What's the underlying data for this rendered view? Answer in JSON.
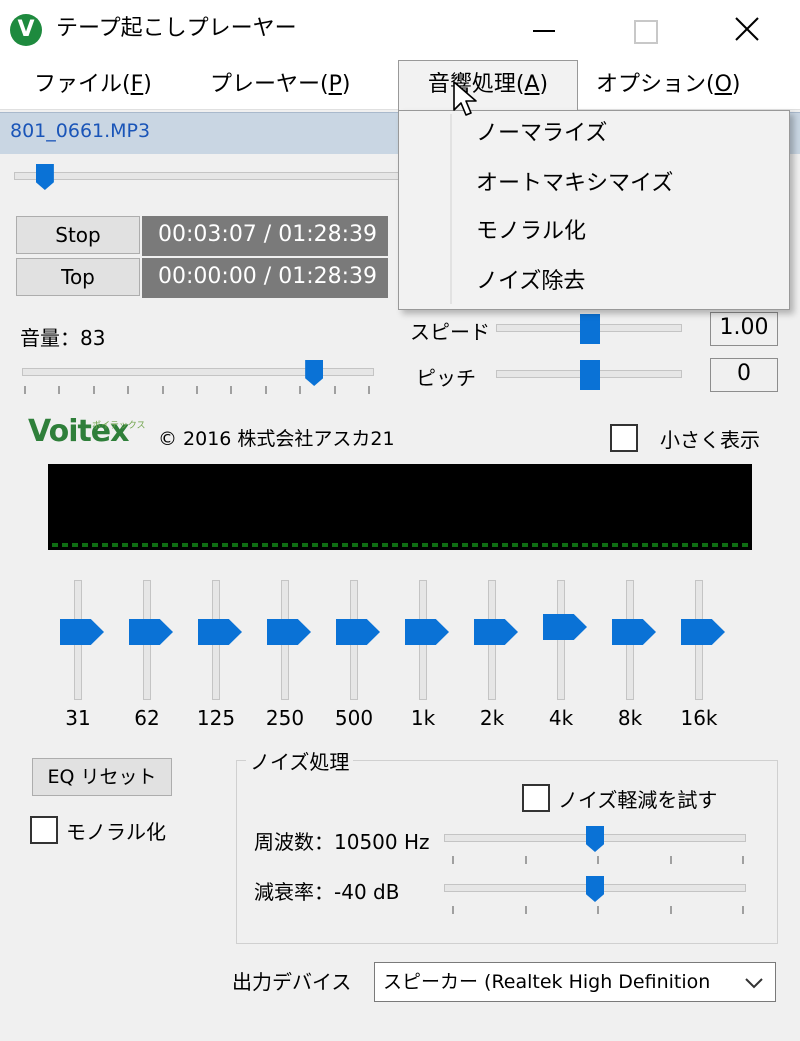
{
  "window": {
    "title": "テープ起こしプレーヤー",
    "icon_letter": "V"
  },
  "menu": {
    "file": {
      "text": "ファイル(",
      "key": "F",
      "end": ")"
    },
    "player": {
      "text": "プレーヤー(",
      "key": "P",
      "end": ")"
    },
    "audio": {
      "text": "音響処理(",
      "key": "A",
      "end": ")"
    },
    "options": {
      "text": "オプション(",
      "key": "O",
      "end": ")"
    }
  },
  "dropdown": {
    "items": [
      "ノーマライズ",
      "オートマキシマイズ",
      "モノラル化",
      "ノイズ除去"
    ]
  },
  "file": {
    "name": "801_0661.MP3"
  },
  "playback": {
    "position_fraction": 0.08,
    "stop_label": "Stop",
    "top_label": "Top",
    "current_time": "00:03:07 / 01:28:39",
    "top_time": "00:00:00 / 01:28:39"
  },
  "volume": {
    "label": "音量：83",
    "value": 83
  },
  "speed": {
    "label": "スピード",
    "value": "1.00"
  },
  "pitch": {
    "label": "ピッチ",
    "value": "0"
  },
  "brand": {
    "logo": "Voitex",
    "logo_ruby": "ボイテックス",
    "copyright": "© 2016 株式会社アスカ21"
  },
  "small_display": {
    "label": "小さく表示",
    "checked": false
  },
  "eq": {
    "bands": [
      "31",
      "62",
      "125",
      "250",
      "500",
      "1k",
      "2k",
      "4k",
      "8k",
      "16k"
    ],
    "reset_label": "EQ リセット"
  },
  "mono": {
    "label": "モノラル化",
    "checked": false
  },
  "noise": {
    "title": "ノイズ処理",
    "try_label": "ノイズ軽減を試す",
    "try_checked": false,
    "freq_label": "周波数：10500 Hz",
    "atten_label": "減衰率：-40 dB"
  },
  "output": {
    "label": "出力デバイス",
    "device": "スピーカー (Realtek High Definition"
  },
  "colors": {
    "accent": "#0a72d6",
    "time_bg": "#7a7a7a",
    "file_bar": "#c9d6e3",
    "logo_green": "#2f7f3a"
  }
}
